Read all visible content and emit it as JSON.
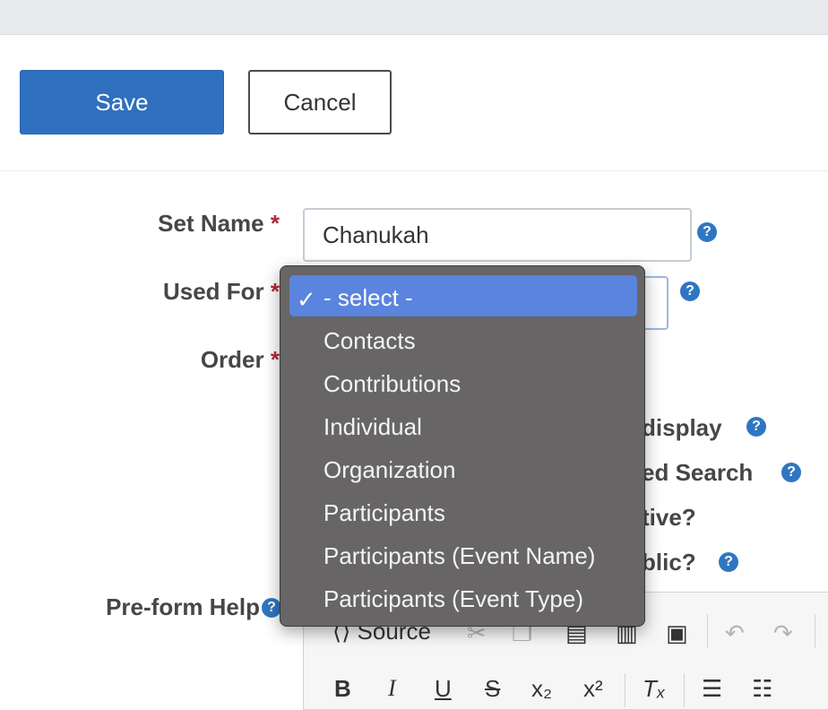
{
  "toolbar": {
    "save_label": "Save",
    "cancel_label": "Cancel"
  },
  "form": {
    "set_name": {
      "label": "Set Name",
      "required_mark": "*",
      "value": "Chanukah",
      "help": "?"
    },
    "used_for": {
      "label": "Used For",
      "required_mark": "*",
      "help": "?"
    },
    "order": {
      "label": "Order",
      "required_mark": "*"
    },
    "partially_hidden": {
      "display_fragment": "display",
      "search_fragment": "ed Search",
      "active_fragment": "tive?",
      "public_fragment": "blic?"
    },
    "pre_form_help": {
      "label": "Pre-form Help",
      "help": "?"
    }
  },
  "editor_toolbar": {
    "source_label": "Source"
  },
  "dropdown": {
    "selected_check": "✓",
    "options": [
      "- select -",
      "Contacts",
      "Contributions",
      "Individual",
      "Organization",
      "Participants",
      "Participants (Event Name)",
      "Participants (Event Type)"
    ]
  },
  "colors": {
    "primary": "#2f70bf",
    "required": "#b2283c",
    "help": "#2f76c2",
    "dropdown_bg": "#676565",
    "dropdown_highlight": "#5a84dd"
  }
}
